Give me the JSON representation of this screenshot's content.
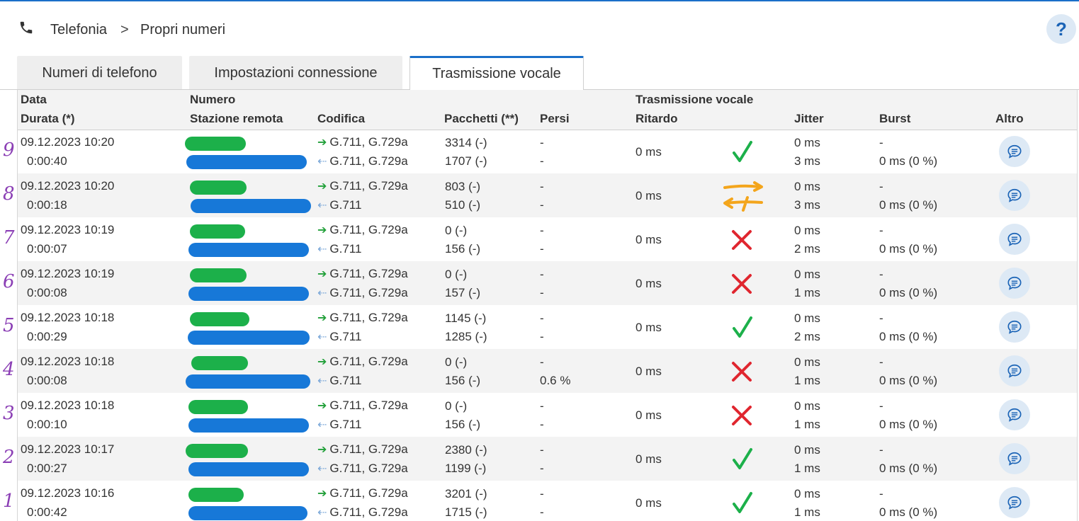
{
  "breadcrumb": {
    "section": "Telefonia",
    "separator": ">",
    "page": "Propri numeri"
  },
  "help_label": "?",
  "tabs": [
    {
      "label": "Numeri di telefono",
      "active": false
    },
    {
      "label": "Impostazioni connessione",
      "active": false
    },
    {
      "label": "Trasmissione vocale",
      "active": true
    }
  ],
  "columns": {
    "data": "Data",
    "durata": "Durata (*)",
    "numero": "Numero",
    "stazione": "Stazione remota",
    "codifica": "Codifica",
    "pacchetti": "Pacchetti (**)",
    "persi": "Persi",
    "trasmissione": "Trasmissione vocale",
    "ritardo": "Ritardo",
    "jitter": "Jitter",
    "burst": "Burst",
    "altro": "Altro"
  },
  "colors": {
    "accent": "#1a6fc9",
    "ok": "#1cb04a",
    "error": "#e0262f",
    "warn": "#f3a51c",
    "annotation": "#8b3fb5"
  },
  "rows": [
    {
      "mark": "9",
      "date": "09.12.2023 10:20",
      "duration": "0:00:40",
      "codec_out": "G.711, G.729a",
      "codec_in": "G.711, G.729a",
      "pk_out": "3314 (-)",
      "pk_in": "1707 (-)",
      "lost_out": "-",
      "lost_in": "-",
      "delay": "0 ms",
      "status": "ok",
      "jitter_out": "0 ms",
      "jitter_in": "3 ms",
      "burst_out": "-",
      "burst_in": "0 ms (0 %)"
    },
    {
      "mark": "8",
      "date": "09.12.2023 10:20",
      "duration": "0:00:18",
      "codec_out": "G.711, G.729a",
      "codec_in": "G.711",
      "pk_out": "803 (-)",
      "pk_in": "510 (-)",
      "lost_out": "-",
      "lost_in": "-",
      "delay": "0 ms",
      "status": "oneway",
      "jitter_out": "0 ms",
      "jitter_in": "3 ms",
      "burst_out": "-",
      "burst_in": "0 ms (0 %)"
    },
    {
      "mark": "7",
      "date": "09.12.2023 10:19",
      "duration": "0:00:07",
      "codec_out": "G.711, G.729a",
      "codec_in": "G.711",
      "pk_out": "0 (-)",
      "pk_in": "156 (-)",
      "lost_out": "-",
      "lost_in": "-",
      "delay": "0 ms",
      "status": "fail",
      "jitter_out": "0 ms",
      "jitter_in": "2 ms",
      "burst_out": "-",
      "burst_in": "0 ms (0 %)"
    },
    {
      "mark": "6",
      "date": "09.12.2023 10:19",
      "duration": "0:00:08",
      "codec_out": "G.711, G.729a",
      "codec_in": "G.711, G.729a",
      "pk_out": "0 (-)",
      "pk_in": "157 (-)",
      "lost_out": "-",
      "lost_in": "-",
      "delay": "0 ms",
      "status": "fail",
      "jitter_out": "0 ms",
      "jitter_in": "1 ms",
      "burst_out": "-",
      "burst_in": "0 ms (0 %)"
    },
    {
      "mark": "5",
      "date": "09.12.2023 10:18",
      "duration": "0:00:29",
      "codec_out": "G.711, G.729a",
      "codec_in": "G.711",
      "pk_out": "1145 (-)",
      "pk_in": "1285 (-)",
      "lost_out": "-",
      "lost_in": "-",
      "delay": "0 ms",
      "status": "ok",
      "jitter_out": "0 ms",
      "jitter_in": "2 ms",
      "burst_out": "-",
      "burst_in": "0 ms (0 %)"
    },
    {
      "mark": "4",
      "date": "09.12.2023 10:18",
      "duration": "0:00:08",
      "codec_out": "G.711, G.729a",
      "codec_in": "G.711",
      "pk_out": "0 (-)",
      "pk_in": "156 (-)",
      "lost_out": "-",
      "lost_in": "0.6 %",
      "delay": "0 ms",
      "status": "fail",
      "jitter_out": "0 ms",
      "jitter_in": "1 ms",
      "burst_out": "-",
      "burst_in": "0 ms (0 %)"
    },
    {
      "mark": "3",
      "date": "09.12.2023 10:18",
      "duration": "0:00:10",
      "codec_out": "G.711, G.729a",
      "codec_in": "G.711",
      "pk_out": "0 (-)",
      "pk_in": "156 (-)",
      "lost_out": "-",
      "lost_in": "-",
      "delay": "0 ms",
      "status": "fail",
      "jitter_out": "0 ms",
      "jitter_in": "1 ms",
      "burst_out": "-",
      "burst_in": "0 ms (0 %)"
    },
    {
      "mark": "2",
      "date": "09.12.2023 10:17",
      "duration": "0:00:27",
      "codec_out": "G.711, G.729a",
      "codec_in": "G.711, G.729a",
      "pk_out": "2380 (-)",
      "pk_in": "1199 (-)",
      "lost_out": "-",
      "lost_in": "-",
      "delay": "0 ms",
      "status": "ok",
      "jitter_out": "0 ms",
      "jitter_in": "1 ms",
      "burst_out": "-",
      "burst_in": "0 ms (0 %)"
    },
    {
      "mark": "1",
      "date": "09.12.2023 10:16",
      "duration": "0:00:42",
      "codec_out": "G.711, G.729a",
      "codec_in": "G.711, G.729a",
      "pk_out": "3201 (-)",
      "pk_in": "1715 (-)",
      "lost_out": "-",
      "lost_in": "-",
      "delay": "0 ms",
      "status": "ok",
      "jitter_out": "0 ms",
      "jitter_in": "1 ms",
      "burst_out": "-",
      "burst_in": "0 ms (0 %)"
    }
  ]
}
